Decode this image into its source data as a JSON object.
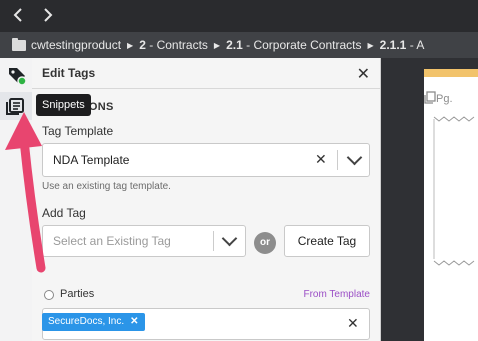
{
  "nav": {
    "back_glyph": "‹",
    "forward_glyph": "›"
  },
  "breadcrumb": {
    "root": "cwtestingproduct",
    "items": [
      {
        "num": "2",
        "text": "- Contracts"
      },
      {
        "num": "2.1",
        "text": "- Corporate Contracts"
      },
      {
        "num": "2.1.1",
        "text": "- A"
      }
    ]
  },
  "sidebar": {
    "icons": [
      "tag-icon",
      "snippets-icon",
      "pen-icon"
    ],
    "tooltip": "Snippets",
    "status_color": "#2fb344"
  },
  "panel": {
    "title": "Edit Tags",
    "section_title": "NG ACTIONS",
    "tag_template_label": "Tag Template",
    "tag_template_value": "NDA Template",
    "tag_template_help": "Use an existing tag template.",
    "add_tag_label": "Add Tag",
    "add_tag_placeholder": "Select an Existing Tag",
    "or_text": "or",
    "create_tag_label": "Create Tag",
    "parties_label": "Parties",
    "from_template": "From Template",
    "party_chip": "SecureDocs, Inc."
  },
  "document": {
    "page_label": "Pg."
  },
  "colors": {
    "accent": "#2b95e8",
    "annotation_arrow": "#e8456f",
    "purple_text": "#9b4fc6"
  }
}
